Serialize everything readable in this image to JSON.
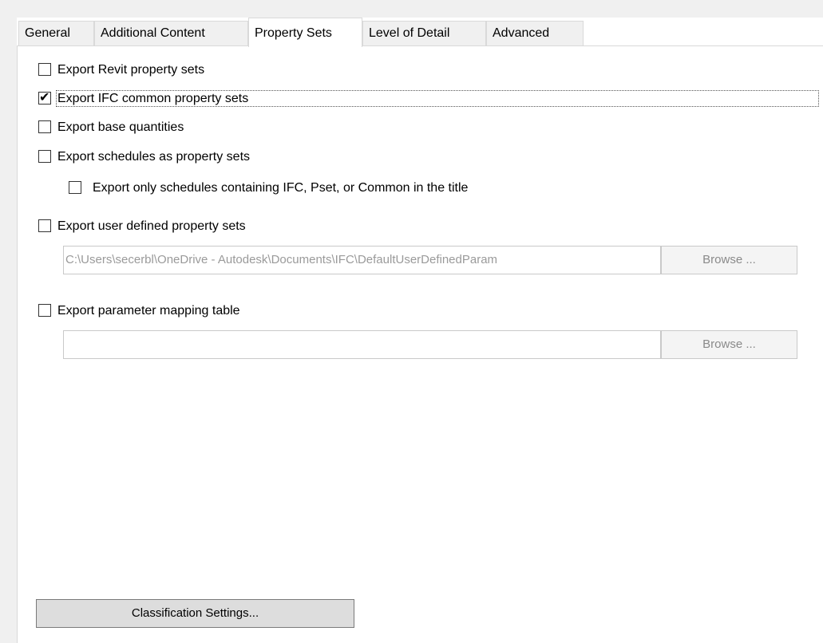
{
  "tabs": [
    {
      "label": "General",
      "active": false
    },
    {
      "label": "Additional Content",
      "active": false
    },
    {
      "label": "Property Sets",
      "active": true
    },
    {
      "label": "Level of Detail",
      "active": false
    },
    {
      "label": "Advanced",
      "active": false
    }
  ],
  "options": {
    "export_revit_property_sets": {
      "label": "Export Revit property sets",
      "checked": false
    },
    "export_ifc_common_property_sets": {
      "label": "Export IFC common property sets",
      "checked": true
    },
    "export_base_quantities": {
      "label": "Export base quantities",
      "checked": false
    },
    "export_schedules": {
      "label": "Export schedules as property sets",
      "checked": false
    },
    "export_only_schedules": {
      "label": "Export only schedules containing IFC, Pset, or Common in the title",
      "checked": false
    },
    "export_user_defined": {
      "label": "Export user defined property sets",
      "checked": false
    },
    "export_parameter_mapping": {
      "label": "Export parameter mapping table",
      "checked": false
    }
  },
  "user_defined_path": {
    "value": "C:\\Users\\secerbl\\OneDrive - Autodesk\\Documents\\IFC\\DefaultUserDefinedParam",
    "browse_label": "Browse ..."
  },
  "parameter_mapping_path": {
    "value": "",
    "browse_label": "Browse ..."
  },
  "classification_button": "Classification Settings...",
  "check_glyph": "✔"
}
